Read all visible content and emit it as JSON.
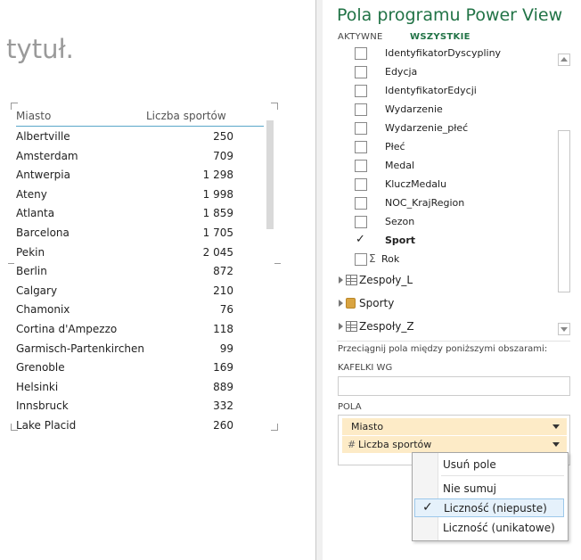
{
  "canvas": {
    "title_placeholder": "ć tytuł.",
    "table": {
      "headers": {
        "city": "Miasto",
        "count": "Liczba sportów"
      },
      "rows": [
        {
          "city": "Albertville",
          "count": "250"
        },
        {
          "city": "Amsterdam",
          "count": "709"
        },
        {
          "city": "Antwerpia",
          "count": "1 298"
        },
        {
          "city": "Ateny",
          "count": "1 998"
        },
        {
          "city": "Atlanta",
          "count": "1 859"
        },
        {
          "city": "Barcelona",
          "count": "1 705"
        },
        {
          "city": "Pekin",
          "count": "2 045"
        },
        {
          "city": "Berlin",
          "count": "872"
        },
        {
          "city": "Calgary",
          "count": "210"
        },
        {
          "city": "Chamonix",
          "count": "76"
        },
        {
          "city": "Cortina d'Ampezzo",
          "count": "118"
        },
        {
          "city": "Garmisch-Partenkirchen",
          "count": "99"
        },
        {
          "city": "Grenoble",
          "count": "169"
        },
        {
          "city": "Helsinki",
          "count": "889"
        },
        {
          "city": "Innsbruck",
          "count": "332"
        },
        {
          "city": "Lake Placid",
          "count": "260"
        }
      ]
    }
  },
  "panel": {
    "title": "Pola programu Power View",
    "tabs": {
      "active": "AKTYWNE",
      "all": "WSZYSTKIE"
    },
    "fields": [
      {
        "label": "IdentyfikatorDyscypliny",
        "checked": false
      },
      {
        "label": "Edycja",
        "checked": false
      },
      {
        "label": "IdentyfikatorEdycji",
        "checked": false
      },
      {
        "label": "Wydarzenie",
        "checked": false
      },
      {
        "label": "Wydarzenie_płeć",
        "checked": false
      },
      {
        "label": "Płeć",
        "checked": false
      },
      {
        "label": "Medal",
        "checked": false
      },
      {
        "label": "KluczMedalu",
        "checked": false
      },
      {
        "label": "NOC_KrajRegion",
        "checked": false
      },
      {
        "label": "Sezon",
        "checked": false
      },
      {
        "label": "Sport",
        "checked": true
      },
      {
        "label": "Rok",
        "checked": false,
        "sigma": "Σ"
      }
    ],
    "groups": [
      {
        "label": "Zespoły_L",
        "icon": "table-icon"
      },
      {
        "label": "Sporty",
        "icon": "database-icon"
      },
      {
        "label": "Zespoły_Z",
        "icon": "table-icon"
      }
    ],
    "drag_hint": "Przeciągnij pola między poniższymi obszarami:",
    "tiles_label": "KAFELKI WG",
    "fields_label": "POLA",
    "field_pills": {
      "city": "Miasto",
      "count_hash": "#",
      "count": "Liczba sportów"
    }
  },
  "context_menu": {
    "remove": "Usuń pole",
    "no_sum": "Nie sumuj",
    "count_nonempty": "Liczność (niepuste)",
    "count_unique": "Liczność (unikatowe)",
    "tick": "✓"
  }
}
